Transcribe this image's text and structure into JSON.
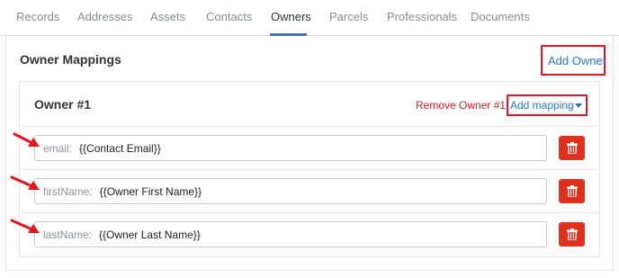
{
  "tabs": [
    {
      "label": "Records"
    },
    {
      "label": "Addresses"
    },
    {
      "label": "Assets"
    },
    {
      "label": "Contacts"
    },
    {
      "label": "Owners"
    },
    {
      "label": "Parcels"
    },
    {
      "label": "Professionals"
    },
    {
      "label": "Documents"
    }
  ],
  "active_tab": "Owners",
  "panel": {
    "title": "Owner Mappings",
    "add_owner_label": "Add Owner"
  },
  "owner": {
    "title": "Owner #1",
    "remove_label": "Remove Owner #1",
    "add_mapping_label": "Add mapping",
    "mappings": [
      {
        "key": "email:",
        "value": "{{Contact Email}}"
      },
      {
        "key": "firstName:",
        "value": "{{Owner First Name}}"
      },
      {
        "key": "lastName:",
        "value": "{{Owner Last Name}}"
      }
    ]
  },
  "colors": {
    "highlight": "#e0152a",
    "link": "#2a78c2",
    "danger_button": "#e0301e",
    "active_tab_underline": "#4f6fb5"
  }
}
